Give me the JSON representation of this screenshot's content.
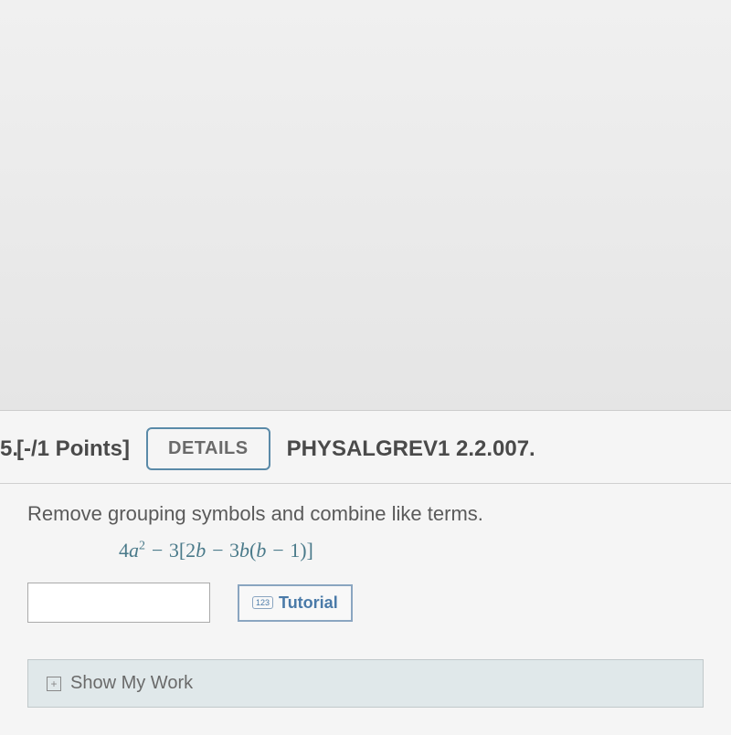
{
  "header": {
    "number": "5.",
    "points": "[-/1 Points]",
    "details_label": "DETAILS",
    "question_id": "PHYSALGREV1 2.2.007."
  },
  "body": {
    "prompt": "Remove grouping symbols and combine like terms.",
    "expression_html": "<span class='num'>4</span>a<sup class='num'>2</sup> − <span class='num'>3[2</span>b − <span class='num'>3</span>b<span class='num'>(</span>b − <span class='num'>1)]</span>"
  },
  "actions": {
    "tutorial_label": "Tutorial",
    "tutorial_icon": "123"
  },
  "footer": {
    "show_work": "Show My Work"
  }
}
